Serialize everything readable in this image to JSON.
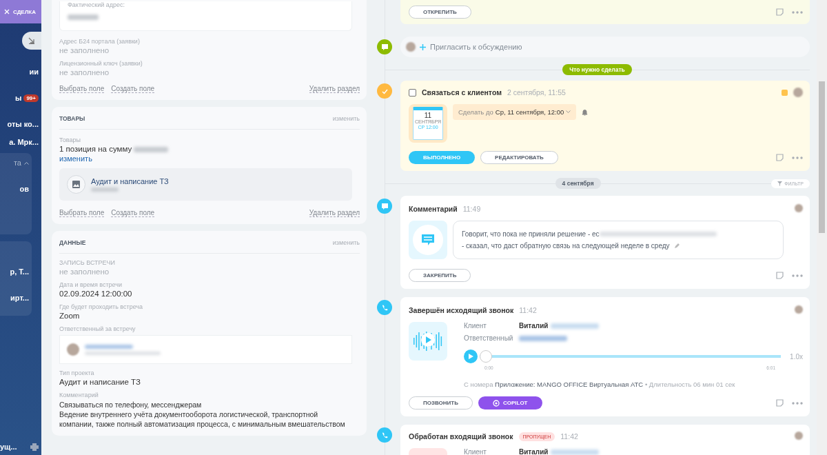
{
  "deal_tab": {
    "label": "СДЕЛКА"
  },
  "sidebar": {
    "items": [
      {
        "label": "ии"
      },
      {
        "label": "ы",
        "badge": "99+"
      },
      {
        "label": "оты ко..."
      },
      {
        "label": "а. Мрк..."
      }
    ],
    "groups": [
      {
        "label": "та",
        "expanded": true,
        "items": [
          {
            "label": "ов"
          }
        ]
      },
      {
        "items": [
          {
            "label": "р, Т..."
          },
          {
            "label": "ирт..."
          }
        ]
      }
    ],
    "footer_item": {
      "label": "ущ..."
    }
  },
  "address_card": {
    "inner_label": "Фактический адрес:",
    "fields": [
      {
        "label": "Адрес Б24 портала (заявки)",
        "value": "не заполнено",
        "empty": true
      },
      {
        "label": "Лицензионный ключ (заявки)",
        "value": "не заполнено",
        "empty": true
      }
    ],
    "links": [
      "Выбрать поле",
      "Создать поле"
    ],
    "delete": "Удалить раздел"
  },
  "products_card": {
    "title": "ТОВАРЫ",
    "action": "изменить",
    "label": "Товары",
    "summary": "1 позиция на сумму",
    "edit": "изменить",
    "product": "Аудит и написание ТЗ",
    "links": [
      "Выбрать поле",
      "Создать поле"
    ],
    "delete": "Удалить раздел"
  },
  "data_card": {
    "title": "ДАННЫЕ",
    "action": "изменить",
    "fields": [
      {
        "kind": "text",
        "label": "ЗАПИСЬ ВСТРЕЧИ",
        "value": "не заполнено",
        "empty": true
      },
      {
        "kind": "text",
        "label": "Дата и время встречи",
        "value": "02.09.2024 12:00:00",
        "empty": false
      },
      {
        "kind": "text",
        "label": "Где будет проходить встреча",
        "value": "Zoom",
        "empty": false
      },
      {
        "kind": "person",
        "label": "Ответственный за встречу"
      },
      {
        "kind": "text",
        "label": "Тип проекта",
        "value": "Аудит и написание ТЗ",
        "empty": false
      },
      {
        "kind": "lines",
        "label": "Комментарий",
        "lines": [
          "Связываться по телефону, мессенджерам",
          "Ведение внутреннего учёта документооборота логистической, транспортной",
          "компании, также полный автоматизация процесса, с минимальным вмешательством"
        ]
      }
    ]
  },
  "timeline": [
    {
      "kind": "pinned",
      "button": "ОТКРЕПИТЬ"
    },
    {
      "kind": "invite",
      "text": "Пригласить к обсуждению"
    },
    {
      "kind": "section",
      "label": "Что нужно сделать"
    },
    {
      "kind": "task",
      "checked": false,
      "title": "Связаться с клиентом",
      "time": "2 сентября, 11:55",
      "day": "11",
      "month": "СЕНТЯБРЯ",
      "weekday": "СР 12:00",
      "deadline_prefix": "Сделать до",
      "deadline": "Ср, 11 сентября, 12:00",
      "buttons": [
        {
          "label": "ВЫПОЛНЕНО",
          "primary": true
        },
        {
          "label": "РЕДАКТИРОВАТЬ",
          "primary": false
        }
      ]
    },
    {
      "kind": "date",
      "label": "4 сентября",
      "filter": "ФИЛЬТР"
    },
    {
      "kind": "comment",
      "title": "Комментарий",
      "time": "11:49",
      "lines": [
        "Говорит, что пока не приняли решение - ес",
        "- сказал, что даст обратную связь на следующей неделе в среду"
      ],
      "button": "ЗАКРЕПИТЬ"
    },
    {
      "kind": "call",
      "missed": false,
      "title": "Завершён исходящий звонок",
      "time": "11:42",
      "client_label": "Клиент",
      "client": "Виталий",
      "owner_label": "Ответственный",
      "level": 0,
      "start": "0:00",
      "end": "6:01",
      "speed": "1.0x",
      "source_label": "С номера",
      "source": "Приложение: MANGO OFFICE Виртуальная АТС",
      "separator": "•",
      "duration": "Длительность 06 мин 01 сек",
      "buttons": [
        {
          "label": "ПОЗВОНИТЬ",
          "primary": false
        },
        {
          "label": "COPILOT",
          "primary": true
        }
      ]
    },
    {
      "kind": "call",
      "missed": true,
      "badge": "ПРОПУЩЕН",
      "title": "Обработан входящий звонок",
      "time": "11:42",
      "client_label": "Клиент",
      "client": "Виталий"
    }
  ]
}
